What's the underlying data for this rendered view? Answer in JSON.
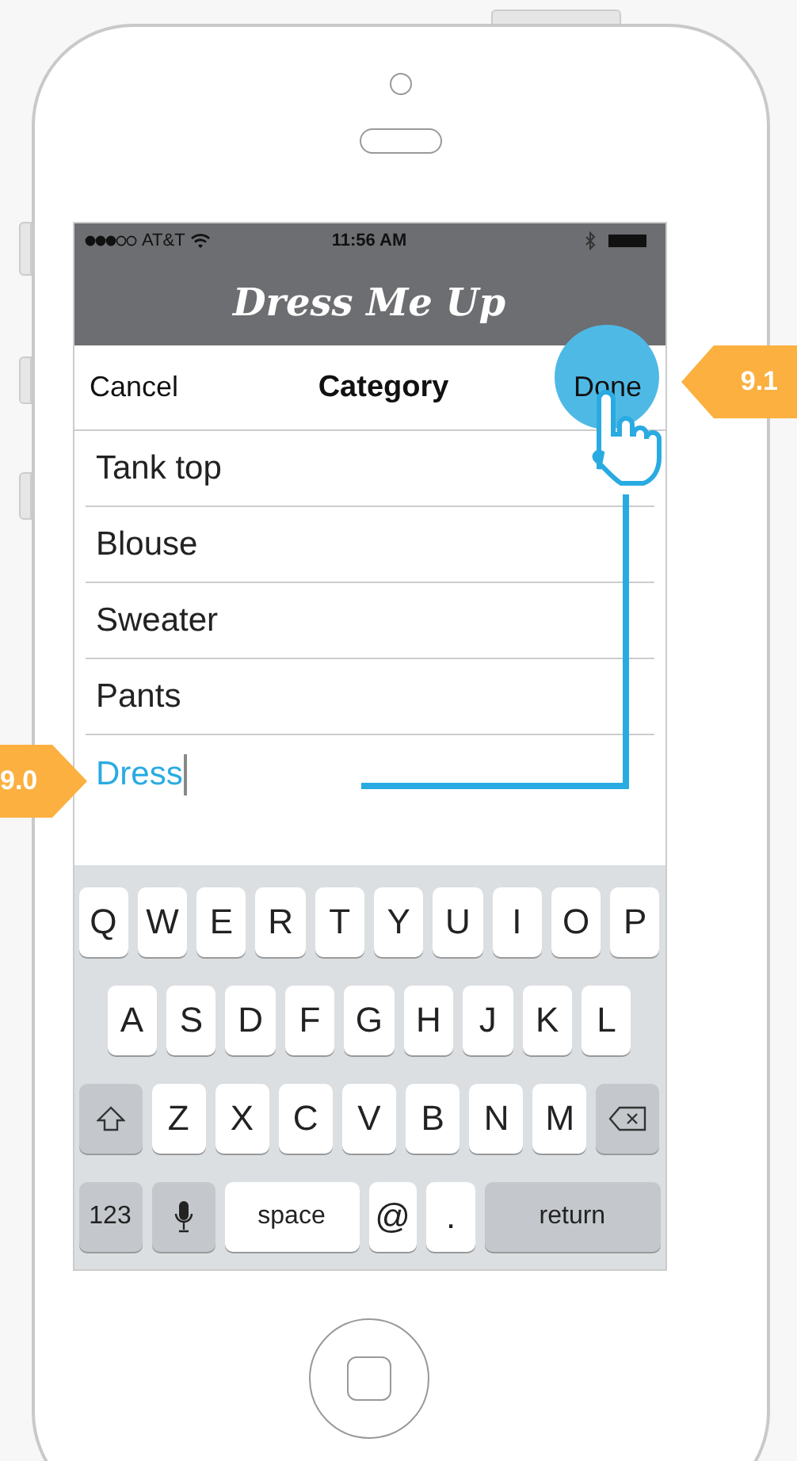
{
  "status_bar": {
    "carrier": "AT&T",
    "time": "11:56 AM"
  },
  "app_title": "Dress Me Up",
  "nav": {
    "cancel": "Cancel",
    "title": "Category",
    "done": "Done"
  },
  "categories": [
    {
      "label": "Tank top"
    },
    {
      "label": "Blouse"
    },
    {
      "label": "Sweater"
    },
    {
      "label": "Pants"
    }
  ],
  "new_category": {
    "value": "Dress"
  },
  "keyboard": {
    "rows": [
      {
        "keys": [
          {
            "kind": "letter",
            "label": "Q"
          },
          {
            "kind": "letter",
            "label": "W"
          },
          {
            "kind": "letter",
            "label": "E"
          },
          {
            "kind": "letter",
            "label": "R"
          },
          {
            "kind": "letter",
            "label": "T"
          },
          {
            "kind": "letter",
            "label": "Y"
          },
          {
            "kind": "letter",
            "label": "U"
          },
          {
            "kind": "letter",
            "label": "I"
          },
          {
            "kind": "letter",
            "label": "O"
          },
          {
            "kind": "letter",
            "label": "P"
          }
        ]
      },
      {
        "keys": [
          {
            "kind": "letter",
            "label": "A"
          },
          {
            "kind": "letter",
            "label": "S"
          },
          {
            "kind": "letter",
            "label": "D"
          },
          {
            "kind": "letter",
            "label": "F"
          },
          {
            "kind": "letter",
            "label": "G"
          },
          {
            "kind": "letter",
            "label": "H"
          },
          {
            "kind": "letter",
            "label": "J"
          },
          {
            "kind": "letter",
            "label": "K"
          },
          {
            "kind": "letter",
            "label": "L"
          }
        ]
      },
      {
        "keys": [
          {
            "kind": "shift"
          },
          {
            "kind": "letter",
            "label": "Z"
          },
          {
            "kind": "letter",
            "label": "X"
          },
          {
            "kind": "letter",
            "label": "C"
          },
          {
            "kind": "letter",
            "label": "V"
          },
          {
            "kind": "letter",
            "label": "B"
          },
          {
            "kind": "letter",
            "label": "N"
          },
          {
            "kind": "letter",
            "label": "M"
          },
          {
            "kind": "delete"
          }
        ]
      },
      {
        "keys": [
          {
            "kind": "function",
            "label": "123"
          },
          {
            "kind": "mic"
          },
          {
            "kind": "space",
            "label": "space"
          },
          {
            "kind": "letter",
            "label": "@"
          },
          {
            "kind": "letter",
            "label": "."
          },
          {
            "kind": "wide",
            "label": "return"
          }
        ]
      }
    ]
  },
  "annotations": [
    {
      "label": "9.1"
    },
    {
      "label": "9.0"
    }
  ]
}
